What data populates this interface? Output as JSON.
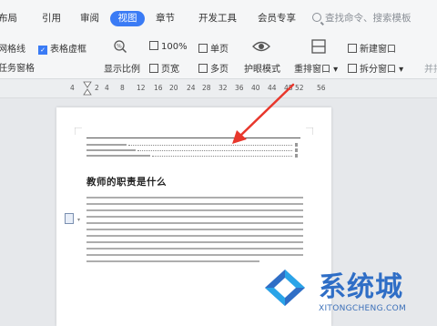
{
  "ribbon_tabs": {
    "layout": "布局",
    "reference": "引用",
    "review": "审阅",
    "view": "视图",
    "section": "章节",
    "devtools": "开发工具",
    "member": "会员专享"
  },
  "search": {
    "placeholder": "查找命令、搜索模板"
  },
  "toolbar": {
    "gridlines": "网格线",
    "table_gridlines": "表格虚框",
    "task_pane": "任务窗格",
    "display_ratio": "显示比例",
    "zoom_100": "100%",
    "single_page": "单页",
    "page_width": "页宽",
    "multi_page": "多页",
    "eye_protection": "护眼模式",
    "rearrange_window": "重排窗口",
    "new_window": "新建窗口",
    "split_window": "拆分窗口",
    "side_by_side": "并排"
  },
  "ruler": {
    "numbers": [
      "4",
      "2",
      "4",
      "8",
      "12",
      "16",
      "20",
      "24",
      "28",
      "32",
      "36",
      "40",
      "44",
      "48",
      "52",
      "56"
    ]
  },
  "document": {
    "title": "教师的职责是什么"
  },
  "watermark": {
    "brand": "系统城",
    "url": "XITONGCHENG.COM"
  },
  "colors": {
    "accent": "#3a7bf5",
    "arrow": "#e8372c",
    "logo_blue": "#2f6ec6",
    "logo_light": "#2aa4e8"
  }
}
